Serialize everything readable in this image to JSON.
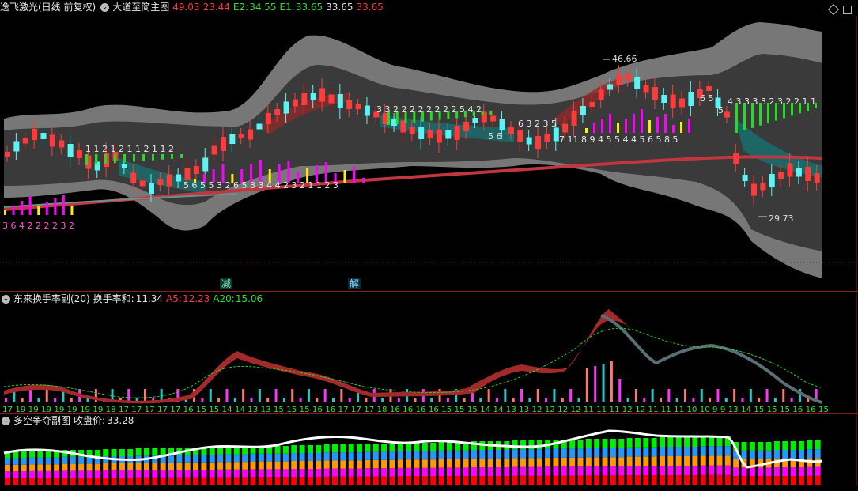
{
  "main": {
    "title": "逸飞激光(日线 前复权)",
    "indicator": "大道至简主图",
    "v1": "49.03",
    "v2": "23.44",
    "e2_label": "E2:",
    "e2": "34.55",
    "e1_label": "E1:",
    "e1": "33.65",
    "v3": "33.65",
    "v4": "33.65",
    "high_label": "46.66",
    "low_label": "29.73",
    "tag_jian": "减",
    "tag_jie": "解",
    "left_nums": "3 6 4 2 2 2 2 3 2",
    "nums_a": "1 1 2 1 2 1 1 2 1 1 2",
    "nums_b": "5 6 5 5 3 2 6 5 3 3 4 4 2 3 2 1 1 2 3",
    "nums_c": "3 3 2 2 2 2 2 2 2 2 5 4 2",
    "nums_d": "5 6",
    "nums_e": "6 3 2 3 5",
    "nums_f": "7 11 8 9 4 5 5 4 4 5 6 5 8 5",
    "nums_g": "6 5",
    "nums_h": "4 3 3 3 3 2 3 2 2 1 1",
    "nums_i": "5"
  },
  "sub1": {
    "title": "东来换手率副(20)",
    "label": "换手率和:",
    "value": "11.34",
    "a5_label": "A5:",
    "a5": "12.23",
    "a20_label": "A20:",
    "a20": "15.06",
    "bottom_nums": "17 19 19 19 19 19 19 19 18 17 17 17 17 17 16 15 15 14 14 13 13 15 15 15 16 16 17 17 17 18 16 16 16 16 15 15 15 14 14 13 13 12 12 12 12 11 11 11 12 12 11 11 11 10 10 9 9 13 14 15 15 15 16 16 15"
  },
  "sub2": {
    "title": "多空争夺副图",
    "label": "收盘价:",
    "value": "33.28"
  },
  "colors": {
    "up": "#ff3b3b",
    "down": "#5ef3f3",
    "magenta": "#ff00ff",
    "green": "#22dd22",
    "band_dark": "#3a3a3a",
    "band_light": "#777777"
  },
  "icons": {
    "info": "chevron-circle-icon",
    "diamond": "diamond-icon",
    "box": "box-icon"
  }
}
